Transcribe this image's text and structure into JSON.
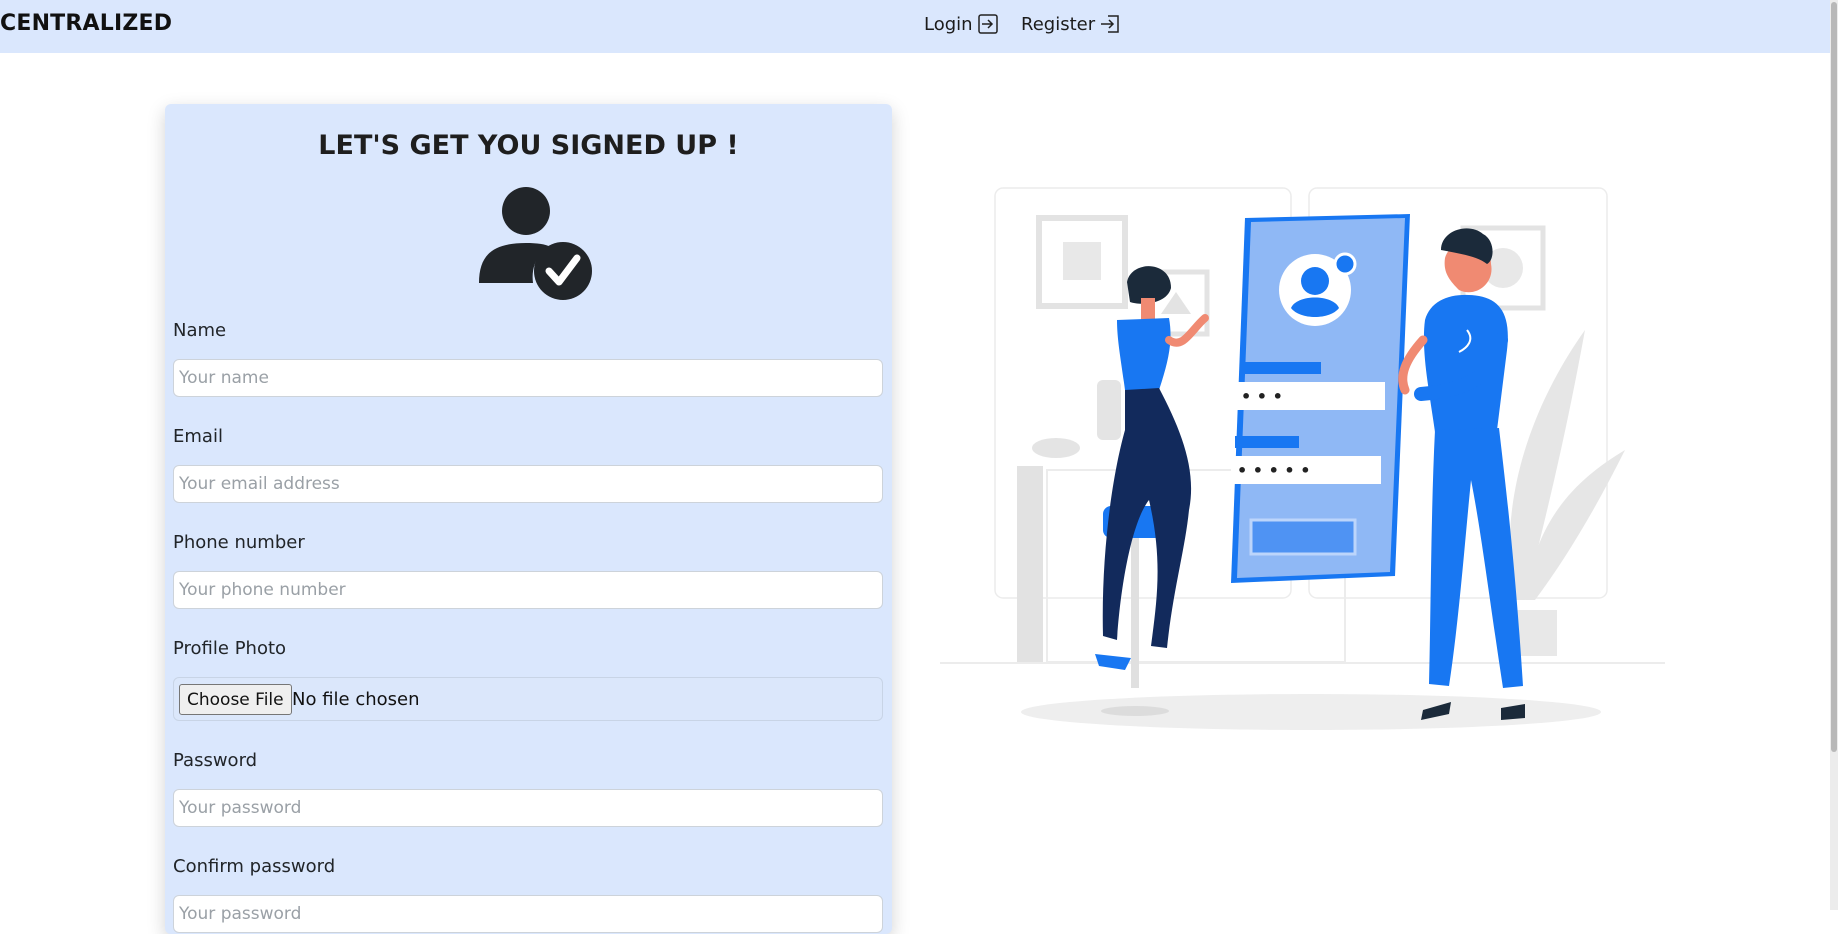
{
  "navbar": {
    "brand": "CENTRALIZED",
    "login_label": "Login",
    "register_label": "Register",
    "login_icon": "box-arrow-in-right-icon",
    "register_icon": "box-arrow-in-right-icon"
  },
  "form": {
    "title": "LET'S GET YOU SIGNED UP !",
    "header_icon": "user-check-icon",
    "fields": [
      {
        "label": "Name",
        "placeholder": "Your name"
      },
      {
        "label": "Email",
        "placeholder": "Your email address"
      },
      {
        "label": "Phone number",
        "placeholder": "Your phone number"
      },
      {
        "label": "Profile Photo",
        "button": "Choose File",
        "status": "No file chosen"
      },
      {
        "label": "Password",
        "placeholder": "Your password"
      },
      {
        "label": "Confirm password",
        "placeholder": "Your password"
      }
    ]
  },
  "illustration": {
    "name": "sign-up-illustration",
    "password_dots_1": "• • •",
    "password_dots_2": "• • • • •"
  },
  "colors": {
    "navbar_bg": "#dae7fd",
    "card_bg": "#dae7fd",
    "accent_blue": "#1877f2",
    "light_blue": "#8fb8f5",
    "dark_navy": "#122a5c"
  }
}
